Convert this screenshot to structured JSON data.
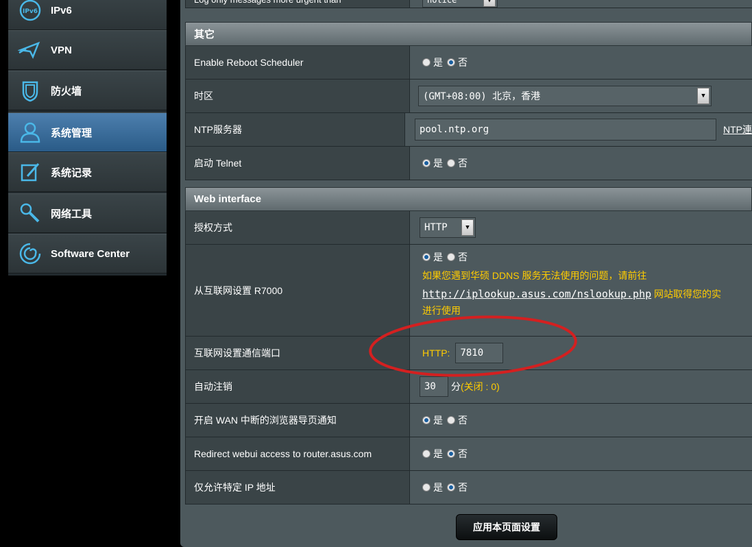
{
  "sidebar": {
    "items": [
      {
        "label": "IPv6",
        "icon": "ipv6-icon"
      },
      {
        "label": "VPN",
        "icon": "vpn-icon"
      },
      {
        "label": "防火墙",
        "icon": "firewall-icon"
      },
      {
        "label": "系统管理",
        "icon": "admin-user-icon"
      },
      {
        "label": "系统记录",
        "icon": "syslog-icon"
      },
      {
        "label": "网络工具",
        "icon": "network-tools-icon"
      },
      {
        "label": "Software Center",
        "icon": "software-center-icon"
      }
    ]
  },
  "top_partial": {
    "label": "Log only messages more urgent than",
    "value": "notice"
  },
  "section_misc": {
    "title": "其它",
    "reboot_label": "Enable Reboot Scheduler",
    "tz_label": "时区",
    "tz_value": "(GMT+08:00) 北京，香港",
    "ntp_label": "NTP服务器",
    "ntp_value": "pool.ntp.org",
    "ntp_link": "NTP連",
    "telnet_label": "启动 Telnet"
  },
  "section_web": {
    "title": "Web interface",
    "auth_label": "授权方式",
    "auth_value": "HTTP",
    "remote_label": "从互联网设置 R7000",
    "remote_note1": "如果您遇到华硕 DDNS 服务无法使用的问题，请前往",
    "remote_link": "http://iplookup.asus.com/nslookup.php",
    "remote_note2": " 网站取得您的实",
    "remote_note3": "进行使用",
    "port_label": "互联网设置通信端口",
    "port_prefix": "HTTP:",
    "port_value": "7810",
    "logout_label": "自动注销",
    "logout_value": "30",
    "logout_unit": "分",
    "logout_note": " (关闭 : 0)",
    "wan_notify_label": "开启 WAN 中断的浏览器导页通知",
    "redirect_label": "Redirect webui access to router.asus.com",
    "ip_restrict_label": "仅允许特定 IP 地址"
  },
  "radio": {
    "yes": "是",
    "no": "否"
  },
  "apply_button": "应用本页面设置",
  "colors": {
    "accent_blue": "#2a5b87",
    "warning_yellow": "#ffcc00",
    "annotation_red": "#d42020"
  }
}
